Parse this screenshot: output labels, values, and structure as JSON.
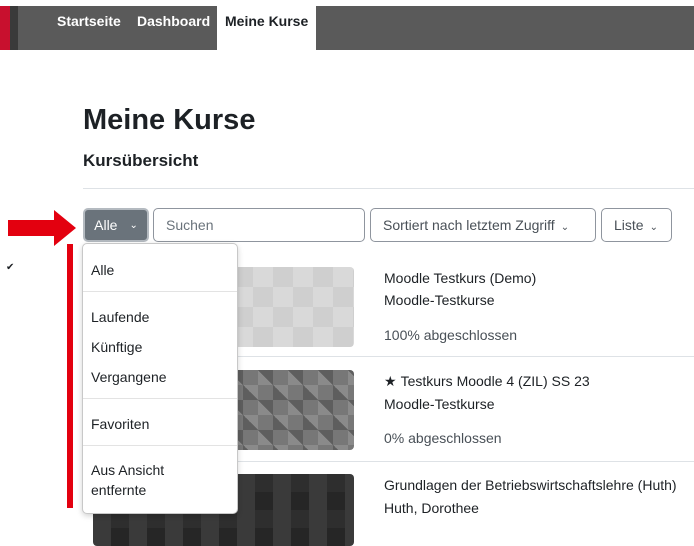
{
  "nav": {
    "items": [
      {
        "label": "Startseite"
      },
      {
        "label": "Dashboard"
      },
      {
        "label": "Meine Kurse",
        "active": true
      }
    ]
  },
  "page_title": "Meine Kurse",
  "section_title": "Kursübersicht",
  "filter": {
    "label": "Alle",
    "menu": {
      "items": [
        "Alle",
        "Laufende",
        "Künftige",
        "Vergangene",
        "Favoriten",
        "Aus Ansicht entfernte"
      ],
      "selected": "Alle"
    }
  },
  "search": {
    "placeholder": "Suchen"
  },
  "sort": {
    "label": "Sortiert nach letztem Zugriff"
  },
  "view": {
    "label": "Liste"
  },
  "courses": [
    {
      "title": "Moodle Testkurs (Demo)",
      "category": "Moodle-Testkurse",
      "progress": "100% abgeschlossen",
      "starred": false
    },
    {
      "title": "Testkurs Moodle 4 (ZIL) SS 23",
      "category": "Moodle-Testkurse",
      "progress": "0% abgeschlossen",
      "starred": true
    },
    {
      "title": "Grundlagen der Betriebswirtschaftslehre (Huth)",
      "category": "Huth, Dorothee",
      "progress": "",
      "starred": false
    }
  ],
  "colors": {
    "brand": "#c8102e",
    "navbar": "#5a5a5a",
    "annotation_red": "#e3000f",
    "filter_button": "#6a737b"
  }
}
